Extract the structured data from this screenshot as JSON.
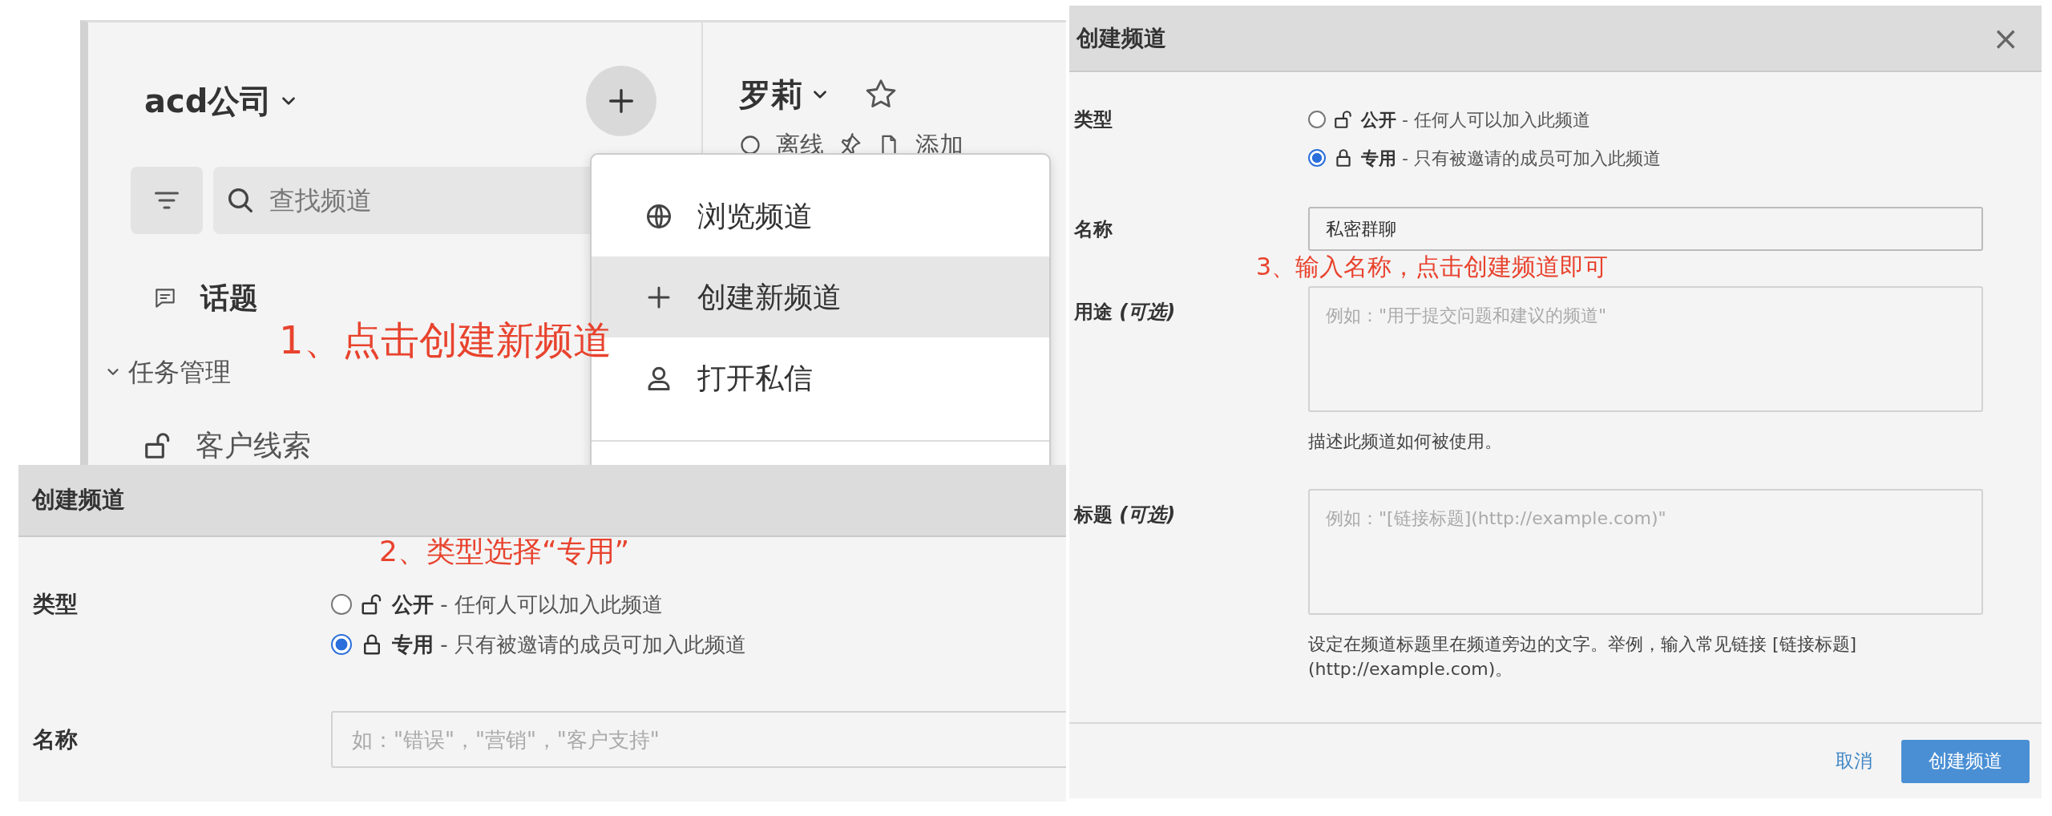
{
  "sidebar_view": {
    "workspace": {
      "name": "acd公司"
    },
    "search": {
      "placeholder": "查找频道"
    },
    "items": [
      {
        "kind": "link",
        "label": "话题"
      },
      {
        "kind": "category",
        "label": "任务管理",
        "expanded": true,
        "children": [
          {
            "kind": "channel",
            "label": "客户线索"
          }
        ]
      }
    ],
    "channel_header": {
      "name": "罗莉",
      "favorite": false,
      "status": "离线",
      "action": "添加"
    },
    "menu": {
      "items": [
        {
          "kind": "globe",
          "label": "浏览频道",
          "selected": false
        },
        {
          "kind": "plus",
          "label": "创建新频道",
          "selected": true
        },
        {
          "kind": "person",
          "label": "打开私信",
          "selected": false
        }
      ]
    },
    "annotation": "1、点击创建新频道"
  },
  "dialog_step_2": {
    "title": "创建频道",
    "annotation": "2、类型选择“专用”",
    "type_label": "类型",
    "types": [
      {
        "kind": "public",
        "label": "**公开** - 任何人可以加入此频道",
        "selected": false
      },
      {
        "kind": "private",
        "label": "**专用** - 只有被邀请的成员可加入此频道",
        "selected": true
      }
    ],
    "fields": [
      {
        "kind": "input",
        "label": "名称",
        "placeholder": "如：\"错误\"，\"营销\"，\"客户支持\""
      }
    ]
  },
  "dialog_step_3": {
    "title": "创建频道",
    "close": "×",
    "annotation": "3、输入名称，点击创建频道即可",
    "type_label": "类型",
    "types": [
      {
        "kind": "public",
        "label": "**公开** - 任何人可以加入此频道",
        "selected": false
      },
      {
        "kind": "private",
        "label": "**专用** - 只有被邀请的成员可加入此频道",
        "selected": true
      }
    ],
    "fields": [
      {
        "kind": "input",
        "label": "名称",
        "value": "私密群聊"
      },
      {
        "kind": "textarea",
        "label": "用途 *(可选)*",
        "placeholder": "例如：\"用于提交问题和建议的频道\"",
        "help": "描述此频道如何被使用。"
      },
      {
        "kind": "textarea",
        "label": "标题 *(可选)*",
        "placeholder": "例如：\"[链接标题](http://example.com)\"",
        "help": "设定在频道标题里在频道旁边的文字。举例，输入常见链接 [链接标题](http://example.com)。"
      }
    ],
    "buttons": [
      {
        "kind": "link",
        "label": "取消"
      },
      {
        "kind": "primary",
        "label": "创建频道"
      }
    ]
  }
}
